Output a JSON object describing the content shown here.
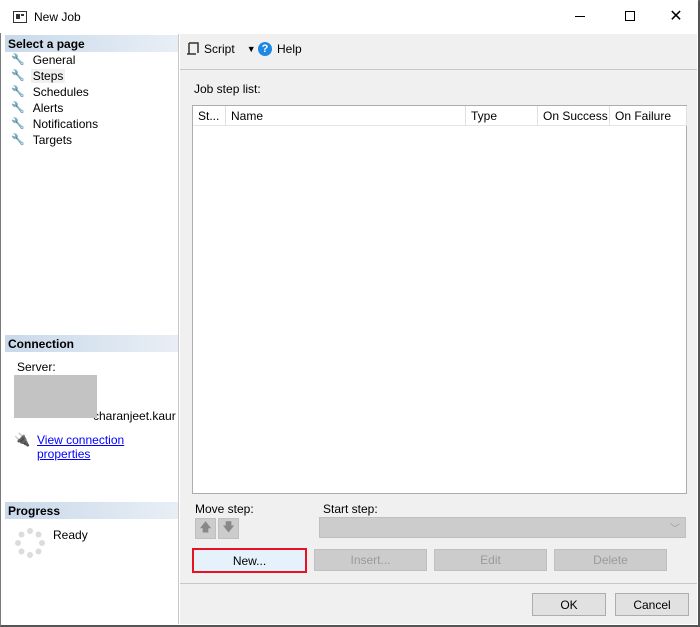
{
  "window": {
    "title": "New Job",
    "icon": "window-icon"
  },
  "left": {
    "select_page_header": "Select a page",
    "pages": [
      {
        "label": "General"
      },
      {
        "label": "Steps",
        "selected": true
      },
      {
        "label": "Schedules"
      },
      {
        "label": "Alerts"
      },
      {
        "label": "Notifications"
      },
      {
        "label": "Targets"
      }
    ],
    "connection_header": "Connection",
    "server_label": "Server:",
    "user_suffix": "charanjeet.kaur",
    "view_connection_link": "View connection properties",
    "progress_header": "Progress",
    "progress_status": "Ready"
  },
  "toolbar": {
    "script_label": "Script",
    "help_label": "Help"
  },
  "main": {
    "job_step_list_label": "Job step list:",
    "columns": [
      "St...",
      "Name",
      "Type",
      "On Success",
      "On Failure"
    ],
    "move_step_label": "Move step:",
    "start_step_label": "Start step:",
    "start_step_value": "",
    "buttons": {
      "new": "New...",
      "insert": "Insert...",
      "edit": "Edit",
      "delete": "Delete"
    }
  },
  "footer": {
    "ok": "OK",
    "cancel": "Cancel"
  },
  "colors": {
    "highlight_border": "#e81123",
    "link": "#0000ff",
    "header_gradient": "#c9d9ea"
  }
}
